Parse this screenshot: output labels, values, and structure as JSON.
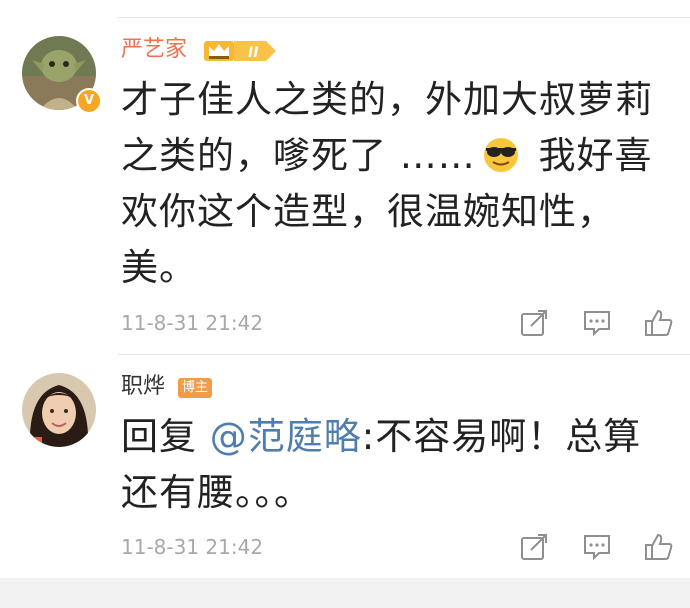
{
  "comments": [
    {
      "username": "严艺家",
      "verified_badge": "V",
      "vip_level": "II",
      "text_before_emoji": "才子佳人之类的，外加大叔萝莉之类的，嗲死了 ……",
      "emoji": "cool-sunglasses-emoji",
      "text_after_emoji": " 我好喜欢你这个造型，很温婉知性，美。",
      "timestamp": "11-8-31 21:42"
    },
    {
      "username": "职烨",
      "badge": "博主",
      "reply_prefix": "回复 ",
      "mention": "@范庭略",
      "reply_text": ":不容易啊！总算还有腰。。。",
      "timestamp": "11-8-31 21:42"
    }
  ],
  "colors": {
    "vip_username": "#eb7350",
    "mention": "#507daf",
    "timestamp": "#a8a8a8",
    "badge_orange": "#f29c4a"
  }
}
